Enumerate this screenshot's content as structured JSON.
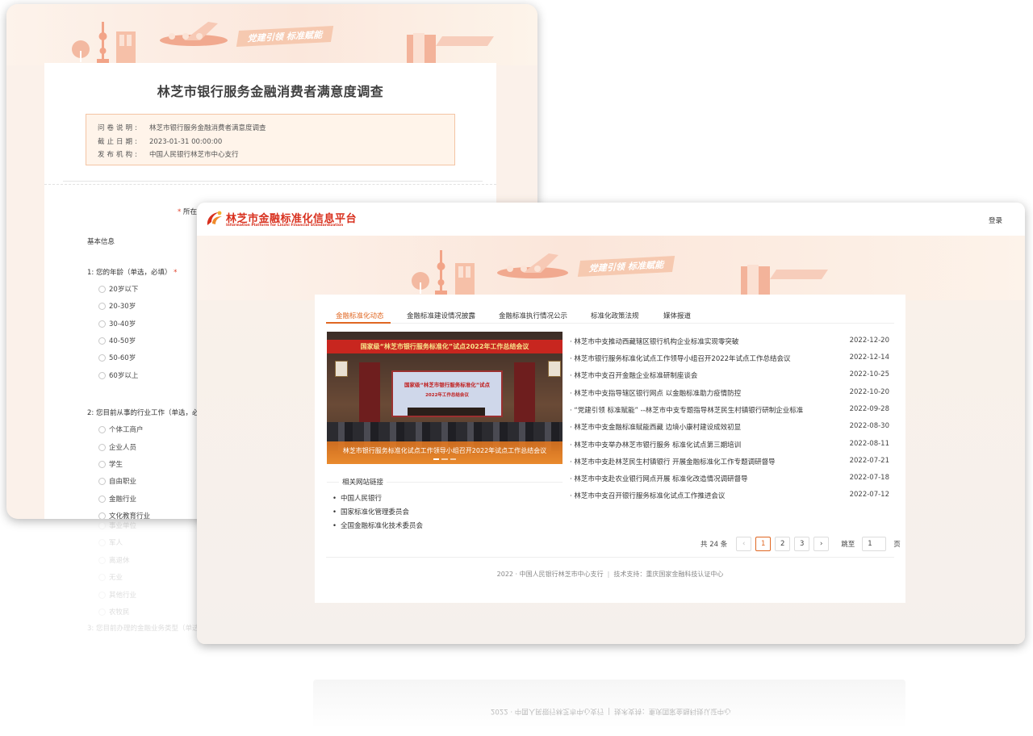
{
  "banner": {
    "slogan": "党建引领  标准赋能"
  },
  "survey": {
    "title": "林芝市银行服务金融消费者满意度调查",
    "info": [
      {
        "label": "问卷说明:",
        "value": "林芝市银行服务金融消费者满意度调查"
      },
      {
        "label": "截止日期:",
        "value": "2023-01-31 00:00:00"
      },
      {
        "label": "发布机构:",
        "value": "中国人民银行林芝市中心支行"
      }
    ],
    "place_label": "所在",
    "section_basic": "基本信息",
    "q1": {
      "text": "1:  您的年龄（单选，必填）",
      "options": [
        "20岁以下",
        "20-30岁",
        "30-40岁",
        "40-50岁",
        "50-60岁",
        "60岁以上"
      ]
    },
    "q2": {
      "text": "2:  您目前从事的行业工作（单选，必",
      "options": [
        "个体工商户",
        "企业人员",
        "学生",
        "自由职业",
        "金融行业",
        "文化教育行业"
      ]
    },
    "reflection_options": [
      "事业单位",
      "军人",
      "离退休",
      "无业",
      "其他行业",
      "农牧民"
    ],
    "reflection_question": "3:  您目前办理的金融业务类型（单选"
  },
  "platform": {
    "logo_cn": "林芝市金融标准化信息平台",
    "logo_en": "Information Platform for Linzhi Financial Standardization",
    "login": "登录",
    "tabs": [
      "金融标准化动态",
      "金融标准建设情况披露",
      "金融标准执行情况公示",
      "标准化政策法规",
      "媒体报道"
    ],
    "photo": {
      "banner_text": "国家级“林芝市银行服务标准化”试点2022年工作总结会议",
      "screen_line1": "国家级“林芝市银行服务标准化”试点",
      "screen_line2": "2022年工作总结会议",
      "caption": "林芝市银行服务标准化试点工作领导小组召开2022年试点工作总结会议"
    },
    "links_title": "相关网站链接",
    "links": [
      "中国人民银行",
      "国家标准化管理委员会",
      "全国金融标准化技术委员会"
    ],
    "news": [
      {
        "title": "· 林芝市中支推动西藏辖区银行机构企业标准实现零突破",
        "date": "2022-12-20"
      },
      {
        "title": "· 林芝市银行服务标准化试点工作领导小组召开2022年试点工作总结会议",
        "date": "2022-12-14"
      },
      {
        "title": "· 林芝市中支召开金融企业标准研制座谈会",
        "date": "2022-10-25"
      },
      {
        "title": "· 林芝市中支指导辖区银行网点 以金融标准助力疫情防控",
        "date": "2022-10-20"
      },
      {
        "title": "· “党建引领 标准赋能” --林芝市中支专题指导林芝民生村镇银行研制企业标准",
        "date": "2022-09-28"
      },
      {
        "title": "· 林芝市中支金融标准赋能西藏 边境小康村建设成效初显",
        "date": "2022-08-30"
      },
      {
        "title": "· 林芝市中支举办林芝市银行服务 标准化试点第三期培训",
        "date": "2022-08-11"
      },
      {
        "title": "· 林芝市中支赴林芝民生村镇银行 开展金融标准化工作专题调研督导",
        "date": "2022-07-21"
      },
      {
        "title": "· 林芝市中支赴农业银行网点开展 标准化改造情况调研督导",
        "date": "2022-07-18"
      },
      {
        "title": "· 林芝市中支召开银行服务标准化试点工作推进会议",
        "date": "2022-07-12"
      }
    ],
    "pager": {
      "total": "共 24 条",
      "prev": "‹",
      "pages": [
        "1",
        "2",
        "3"
      ],
      "next": "›",
      "jump": "跳至",
      "input_value": "1",
      "unit": "页"
    },
    "footer": {
      "copyright": "2022 · 中国人民银行林芝市中心支行",
      "support": "技术支持：重庆国家金融科技认证中心"
    }
  },
  "colors": {
    "accent": "#e06722",
    "brand_red": "#d8301e",
    "banner_peach": "#f6c9b0"
  }
}
